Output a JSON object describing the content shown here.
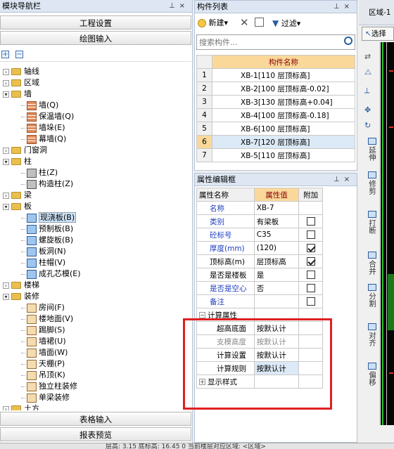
{
  "nav": {
    "title": "模块导航栏",
    "btn_project": "工程设置",
    "btn_draw": "绘图输入",
    "btn_table": "表格输入",
    "btn_report": "报表预览",
    "tree": [
      {
        "label": "轴线",
        "level": 0,
        "type": "folder",
        "expanded": false
      },
      {
        "label": "区域",
        "level": 0,
        "type": "folder",
        "expanded": false
      },
      {
        "label": "墙",
        "level": 0,
        "type": "folder",
        "expanded": true
      },
      {
        "label": "墙(Q)",
        "level": 1,
        "type": "brick"
      },
      {
        "label": "保温墙(Q)",
        "level": 1,
        "type": "brick"
      },
      {
        "label": "墙垛(E)",
        "level": 1,
        "type": "brick"
      },
      {
        "label": "幕墙(Q)",
        "level": 1,
        "type": "brick"
      },
      {
        "label": "门窗洞",
        "level": 0,
        "type": "folder",
        "expanded": false
      },
      {
        "label": "柱",
        "level": 0,
        "type": "folder",
        "expanded": true
      },
      {
        "label": "柱(Z)",
        "level": 1,
        "type": "col"
      },
      {
        "label": "构造柱(Z)",
        "level": 1,
        "type": "col"
      },
      {
        "label": "梁",
        "level": 0,
        "type": "folder",
        "expanded": false
      },
      {
        "label": "板",
        "level": 0,
        "type": "folder",
        "expanded": true
      },
      {
        "label": "现浇板(B)",
        "level": 1,
        "type": "slab",
        "selected": true
      },
      {
        "label": "预制板(B)",
        "level": 1,
        "type": "slab"
      },
      {
        "label": "螺旋板(B)",
        "level": 1,
        "type": "slab"
      },
      {
        "label": "板洞(N)",
        "level": 1,
        "type": "slab"
      },
      {
        "label": "柱帽(V)",
        "level": 1,
        "type": "slab"
      },
      {
        "label": "成孔芯模(E)",
        "level": 1,
        "type": "slab"
      },
      {
        "label": "楼梯",
        "level": 0,
        "type": "folder",
        "expanded": false
      },
      {
        "label": "装修",
        "level": 0,
        "type": "folder",
        "expanded": true
      },
      {
        "label": "房间(F)",
        "level": 1,
        "type": "room"
      },
      {
        "label": "楼地面(V)",
        "level": 1,
        "type": "room"
      },
      {
        "label": "踢脚(S)",
        "level": 1,
        "type": "room"
      },
      {
        "label": "墙裙(U)",
        "level": 1,
        "type": "room"
      },
      {
        "label": "墙面(W)",
        "level": 1,
        "type": "room"
      },
      {
        "label": "天棚(P)",
        "level": 1,
        "type": "room"
      },
      {
        "label": "吊顶(K)",
        "level": 1,
        "type": "room"
      },
      {
        "label": "独立柱装修",
        "level": 1,
        "type": "room"
      },
      {
        "label": "单梁装修",
        "level": 1,
        "type": "room"
      },
      {
        "label": "土方",
        "level": 0,
        "type": "folder",
        "expanded": false
      }
    ]
  },
  "components": {
    "title": "构件列表",
    "btn_new": "新建",
    "btn_filter": "过滤",
    "search_placeholder": "搜索构件...",
    "col_header": "构件名称",
    "rows": [
      {
        "no": "1",
        "name": "XB-1[110 层顶标高]"
      },
      {
        "no": "2",
        "name": "XB-2[100 层顶标高-0.02]"
      },
      {
        "no": "3",
        "name": "XB-3[130 层顶标高+0.04]"
      },
      {
        "no": "4",
        "name": "XB-4[100 层顶标高-0.18]"
      },
      {
        "no": "5",
        "name": "XB-6[100 层顶标高]"
      },
      {
        "no": "6",
        "name": "XB-7[120 层顶标高]"
      },
      {
        "no": "7",
        "name": "XB-5[110 层顶标高]"
      }
    ],
    "selected_index": 5
  },
  "props": {
    "title": "属性编辑框",
    "col_name": "属性名称",
    "col_value": "属性值",
    "col_extra": "附加",
    "rows": [
      {
        "name": "名称",
        "value": "XB-7",
        "style": "blue",
        "cb": null
      },
      {
        "name": "类别",
        "value": "有梁板",
        "style": "blue",
        "cb": false
      },
      {
        "name": "砼标号",
        "value": "C35",
        "style": "blue",
        "cb": false
      },
      {
        "name": "厚度(mm)",
        "value": "(120)",
        "style": "blue",
        "cb": true
      },
      {
        "name": "顶标高(m)",
        "value": "层顶标高",
        "style": "black",
        "cb": true
      },
      {
        "name": "是否是楼板",
        "value": "是",
        "style": "black",
        "cb": false
      },
      {
        "name": "是否是空心",
        "value": "否",
        "style": "blue",
        "cb": false
      },
      {
        "name": "备注",
        "value": "",
        "style": "blue",
        "cb": false
      }
    ],
    "group_calc": "计算属性",
    "calc_rows": [
      {
        "name": "超高底面",
        "value": "按默认计",
        "style": "black"
      },
      {
        "name": "支模高度",
        "value": "按默认计",
        "style": "gray"
      },
      {
        "name": "计算设置",
        "value": "按默认计",
        "style": "black"
      },
      {
        "name": "计算规则",
        "value": "按默认计",
        "style": "black",
        "highlight": true
      }
    ],
    "group_display": "显示样式"
  },
  "canvas": {
    "tab": "区域-1",
    "select_label": "选择"
  },
  "right_tools": [
    {
      "label": "延伸"
    },
    {
      "label": "修剪"
    },
    {
      "label": "打断"
    },
    {
      "label": "合并"
    },
    {
      "label": "分割"
    },
    {
      "label": "对齐"
    },
    {
      "label": "偏移"
    }
  ],
  "status": {
    "text": "层高: 3.15    底标高: 16.45    0    当前楼层对应区域: <区域>"
  }
}
